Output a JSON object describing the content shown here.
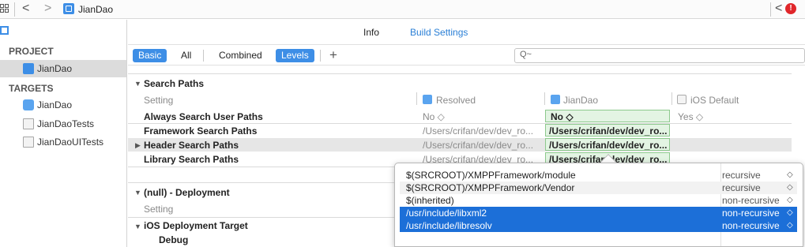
{
  "jumpbar": {
    "back": "<",
    "forward": ">",
    "project": "JianDao",
    "nav_back": "<",
    "error": "!"
  },
  "tabs": {
    "info": "Info",
    "build_settings": "Build Settings"
  },
  "sidebar": {
    "project_header": "PROJECT",
    "project": "JianDao",
    "targets_header": "TARGETS",
    "targets": [
      "JianDao",
      "JianDaoTests",
      "JianDaoUITests"
    ]
  },
  "filter": {
    "basic": "Basic",
    "all": "All",
    "combined": "Combined",
    "levels": "Levels",
    "add": "+",
    "search_glyph": "Q~"
  },
  "settings": {
    "search_paths_section": "Search Paths",
    "column_setting": "Setting",
    "column_resolved": "Resolved",
    "column_target": "JianDao",
    "column_default": "iOS Default",
    "rows": [
      {
        "name": "Always Search User Paths",
        "resolved": "No ◇",
        "target": "No ◇",
        "default": "Yes ◇"
      },
      {
        "name": "Framework Search Paths",
        "resolved": "/Users/crifan/dev/dev_ro...",
        "target": "/Users/crifan/dev/dev_ro..."
      },
      {
        "name": "Header Search Paths",
        "resolved": "/Users/crifan/dev/dev_ro...",
        "target": "/Users/crifan/dev/dev_ro..."
      },
      {
        "name": "Library Search Paths",
        "resolved": "/Users/crifan/dev/dev_ro...",
        "target": "/Users/crifan/dev/dev_ro..."
      }
    ],
    "deployment_section": "(null) - Deployment",
    "deployment_setting": "Setting",
    "ios_target": "iOS Deployment Target",
    "debug": "Debug"
  },
  "popover": {
    "rows": [
      {
        "path": "$(SRCROOT)/XMPPFramework/module",
        "mode": "recursive"
      },
      {
        "path": "$(SRCROOT)/XMPPFramework/Vendor",
        "mode": "recursive"
      },
      {
        "path": "$(inherited)",
        "mode": "non-recursive"
      },
      {
        "path": "/usr/include/libxml2",
        "mode": "non-recursive"
      },
      {
        "path": "/usr/include/libresolv",
        "mode": "non-recursive"
      }
    ],
    "stepper": "◇"
  },
  "colors": {
    "accent": "#3d8ee6",
    "selection": "#1c6fd8",
    "link": "#2a7fd6"
  }
}
